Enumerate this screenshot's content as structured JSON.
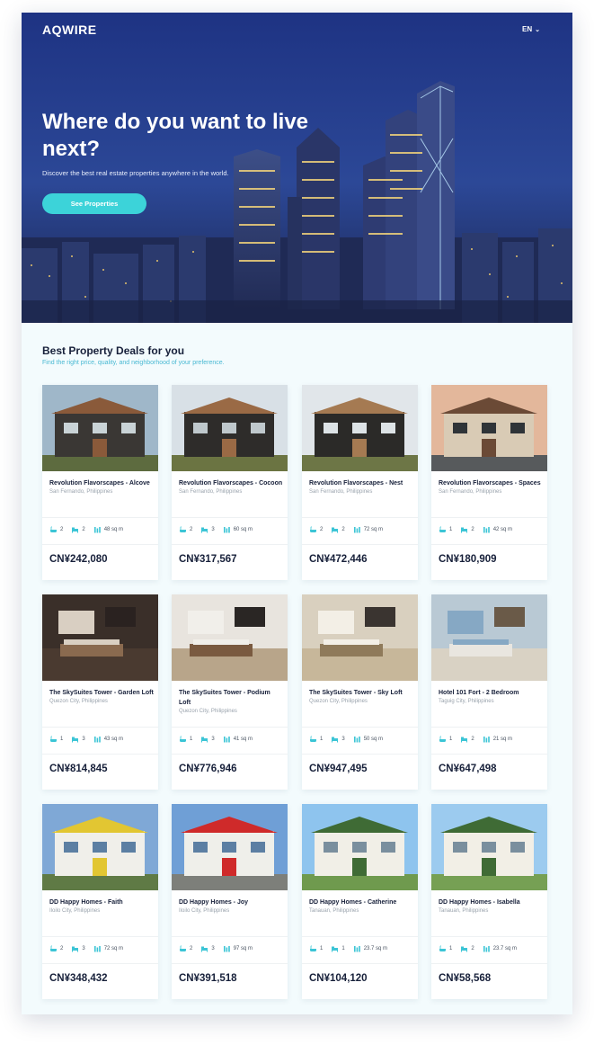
{
  "header": {
    "logo": "AQWIRE",
    "language": "EN"
  },
  "hero": {
    "title": "Where do you want to live next?",
    "subtitle": "Discover the best real estate properties anywhere in the world.",
    "cta_label": "See Properties"
  },
  "section": {
    "title": "Best Property Deals for you",
    "subtitle": "Find the right price, quality, and neighborhood of your preference."
  },
  "properties": [
    {
      "name": "Revolution Flavorscapes - Alcove",
      "location": "San Fernando, Philippines",
      "baths": "2",
      "beds": "2",
      "area": "48 sq m",
      "price": "CN¥242,080"
    },
    {
      "name": "Revolution Flavorscapes - Cocoon",
      "location": "San Fernando, Philippines",
      "baths": "2",
      "beds": "3",
      "area": "60 sq m",
      "price": "CN¥317,567"
    },
    {
      "name": "Revolution Flavorscapes - Nest",
      "location": "San Fernando, Philippines",
      "baths": "2",
      "beds": "2",
      "area": "72 sq m",
      "price": "CN¥472,446"
    },
    {
      "name": "Revolution Flavorscapes - Spaces",
      "location": "San Fernando, Philippines",
      "baths": "1",
      "beds": "2",
      "area": "42 sq m",
      "price": "CN¥180,909"
    },
    {
      "name": "The SkySuites Tower - Garden Loft",
      "location": "Quezon City, Philippines",
      "baths": "1",
      "beds": "3",
      "area": "43 sq m",
      "price": "CN¥814,845"
    },
    {
      "name": "The SkySuites Tower - Podium Loft",
      "location": "Quezon City, Philippines",
      "baths": "1",
      "beds": "3",
      "area": "41 sq m",
      "price": "CN¥776,946"
    },
    {
      "name": "The SkySuites Tower - Sky Loft",
      "location": "Quezon City, Philippines",
      "baths": "1",
      "beds": "3",
      "area": "50 sq m",
      "price": "CN¥947,495"
    },
    {
      "name": "Hotel 101 Fort - 2 Bedroom",
      "location": "Taguig City, Philippines",
      "baths": "1",
      "beds": "2",
      "area": "21 sq m",
      "price": "CN¥647,498"
    },
    {
      "name": "DD Happy Homes - Faith",
      "location": "Iloilo City, Philippines",
      "baths": "2",
      "beds": "3",
      "area": "72 sq m",
      "price": "CN¥348,432"
    },
    {
      "name": "DD Happy Homes - Joy",
      "location": "Iloilo City, Philippines",
      "baths": "2",
      "beds": "3",
      "area": "97 sq m",
      "price": "CN¥391,518"
    },
    {
      "name": "DD Happy Homes - Catherine",
      "location": "Tanauan, Philippines",
      "baths": "1",
      "beds": "1",
      "area": "23.7 sq m",
      "price": "CN¥104,120"
    },
    {
      "name": "DD Happy Homes - Isabella",
      "location": "Tanauan, Philippines",
      "baths": "1",
      "beds": "2",
      "area": "23.7 sq m",
      "price": "CN¥58,568"
    }
  ],
  "colors": {
    "accent": "#3cd3d9",
    "text": "#17203a",
    "muted": "#9aa3ad",
    "hero_dark": "#1f3585"
  }
}
